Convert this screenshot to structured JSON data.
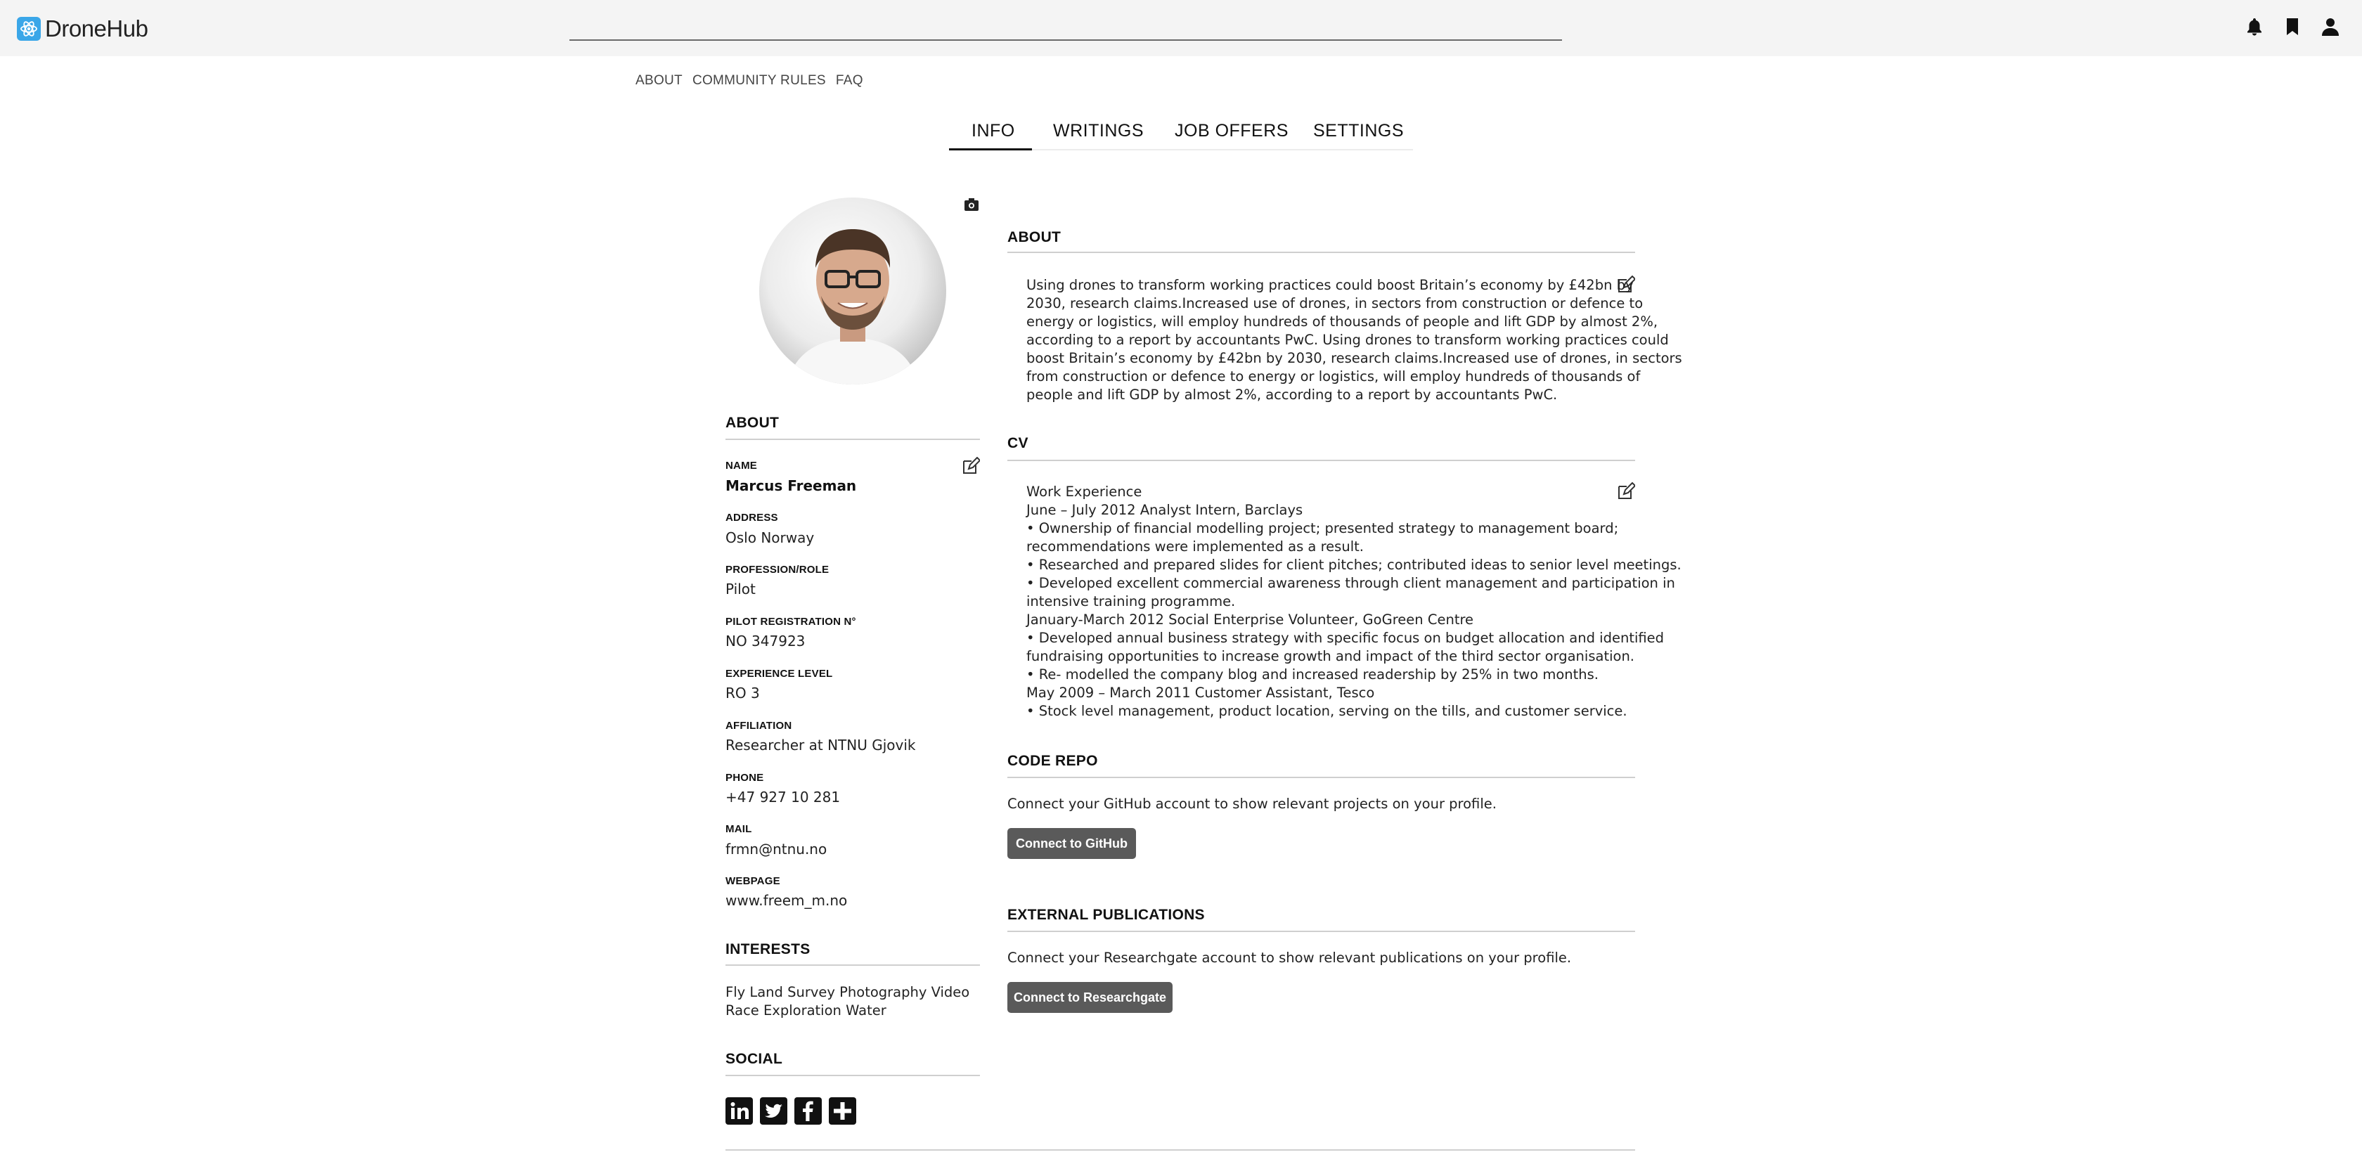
{
  "app": {
    "name": "DroneHub"
  },
  "topnav": [
    "ABOUT",
    "COMMUNITY RULES",
    "FAQ"
  ],
  "tabs": [
    "INFO",
    "WRITINGS",
    "JOB OFFERS",
    "SETTINGS"
  ],
  "active_tab": "INFO",
  "sidebar": {
    "about_heading": "ABOUT",
    "fields": [
      {
        "label": "NAME",
        "value": "Marcus Freeman"
      },
      {
        "label": "ADDRESS",
        "value": "Oslo Norway"
      },
      {
        "label": "PROFESSION/ROLE",
        "value": "Pilot"
      },
      {
        "label": "PILOT REGISTRATION N°",
        "value": "NO 347923"
      },
      {
        "label": "EXPERIENCE LEVEL",
        "value": "RO 3"
      },
      {
        "label": "AFFILIATION",
        "value": "Researcher at NTNU Gjovik"
      },
      {
        "label": "PHONE",
        "value": "+47 927 10 281"
      },
      {
        "label": "MAIL",
        "value": "frmn@ntnu.no"
      },
      {
        "label": "WEBPAGE",
        "value": "www.freem_m.no"
      }
    ],
    "interests_heading": "INTERESTS",
    "interests_lines": [
      "Fly Land Survey Photography Video",
      "Race Exploration Water"
    ],
    "social_heading": "SOCIAL",
    "social_icons": [
      "linkedin-icon",
      "twitter-icon",
      "facebook-icon",
      "plus-icon"
    ]
  },
  "main": {
    "about_heading": "ABOUT",
    "about_lines": [
      "Using drones to transform working practices could boost Britain’s economy by £42bn by",
      "2030, research claims.Increased use of drones, in sectors from construction or defence to",
      "energy or logistics, will employ hundreds of thousands of people and lift GDP by almost 2%,",
      "according to a report by accountants PwC. Using drones to transform working practices could",
      "boost Britain’s economy by £42bn by 2030, research claims.Increased use of drones, in sectors",
      "from construction or defence to energy or logistics, will employ hundreds of thousands of",
      "people and lift GDP by almost 2%, according to a report by accountants PwC."
    ],
    "cv_heading": "CV",
    "cv_lines": [
      "Work Experience",
      "June – July 2012 Analyst Intern, Barclays",
      "• Ownership of financial modelling project; presented strategy to management board;",
      "recommendations were implemented as a result.",
      "• Researched and prepared slides for client pitches; contributed ideas to senior level meetings.",
      "• Developed excellent commercial awareness through client management and participation in",
      "intensive training programme.",
      "January-March 2012 Social Enterprise Volunteer, GoGreen Centre",
      "• Developed annual business strategy with specific focus on budget allocation and identified",
      "fundraising opportunities to increase growth and impact of the third sector organisation.",
      "• Re- modelled the company blog and increased readership by 25% in two months.",
      "May 2009 – March 2011 Customer Assistant, Tesco",
      "• Stock level management, product location, serving on the tills, and customer service."
    ],
    "code_repo_heading": "CODE REPO",
    "code_repo_text": "Connect your GitHub account to show relevant projects on your profile.",
    "github_button": "Connect to GitHub",
    "publications_heading": "EXTERNAL PUBLICATIONS",
    "publications_text": "Connect your Researchgate account to show relevant publications on your profile.",
    "researchgate_button": "Connect to Researchgate"
  }
}
